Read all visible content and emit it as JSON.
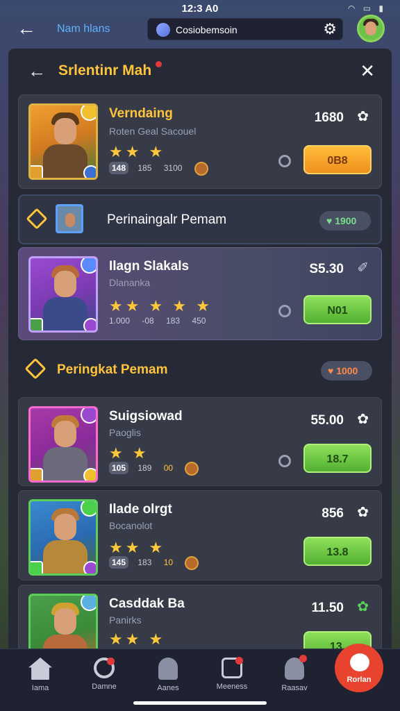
{
  "status_bar": {
    "time": "12:3 A0"
  },
  "app_bar": {
    "title": "Nam hlans",
    "search_text": "Cosiobemsoin",
    "icons": [
      "back-arrow-icon",
      "search-icon",
      "gear-icon",
      "avatar"
    ]
  },
  "panel": {
    "title": "Srlentinr Mah",
    "cards": [
      {
        "name": "Verndaing",
        "subtitle": "Roten Geal Sacouel",
        "stars": "★★ ★",
        "stat_level": "148",
        "stat_a": "185",
        "stat_b": "3100",
        "price": "1680",
        "price_icon": "✿",
        "button": "0B8",
        "button_style": "orange",
        "portrait_colors": [
          "#f0a030",
          "#6a4a2a",
          "#4a7a3a"
        ]
      }
    ],
    "section_1": {
      "title": "Perinaingalr Pemam",
      "pill": "1900",
      "pill_color": "#7adc8a"
    },
    "highlight_card": {
      "name": "Ilagn Slakals",
      "subtitle": "Dlananka",
      "stars": "★★ ★ ★ ★",
      "stat_a": "1.000",
      "stat_b": "-08",
      "stat_c": "183",
      "stat_d": "450",
      "price": "S5.30",
      "price_icon": "✐",
      "button": "N01",
      "portrait_colors": [
        "#9a4ad0",
        "#b86a3a",
        "#3a4a8a"
      ]
    },
    "section_2": {
      "title": "Peringkat Pemam",
      "pill": "1000",
      "pill_color": "#ff8a4a"
    },
    "cards_2": [
      {
        "name": "Suigsiowad",
        "subtitle": "Paoglis",
        "stars": "★ ★",
        "stat_level": "105",
        "stat_a": "189",
        "stat_b": "00",
        "price": "55.00",
        "price_icon": "✿",
        "button": "18.7",
        "portrait_colors": [
          "#a83aa8",
          "#c07a3a",
          "#5a5a6a"
        ]
      },
      {
        "name": "Ilade olrgt",
        "subtitle": "Bocanolot",
        "stars": "★★ ★",
        "stat_level": "145",
        "stat_a": "183",
        "stat_b": "10",
        "price": "856",
        "price_icon": "✿",
        "button": "13.8",
        "portrait_colors": [
          "#3a8ad0",
          "#b8783a",
          "#4a6a3a"
        ]
      },
      {
        "name": "Casddak Ba",
        "subtitle": "Panirks",
        "stars": "★★ ★",
        "price": "11.50",
        "price_icon": "✿",
        "button": "13.",
        "portrait_colors": [
          "#4aa04a",
          "#d0a030",
          "#b86a3a"
        ]
      }
    ]
  },
  "bottom_nav": {
    "items": [
      {
        "label": "Iama",
        "icon": "home-icon"
      },
      {
        "label": "Damne",
        "icon": "ring-icon",
        "dot": true
      },
      {
        "label": "Aanes",
        "icon": "character-icon"
      },
      {
        "label": "Meeness",
        "icon": "gallery-icon",
        "dot": true
      },
      {
        "label": "Raasav",
        "icon": "profile-icon",
        "dot": true
      }
    ],
    "fab_label": "Rorlan"
  }
}
